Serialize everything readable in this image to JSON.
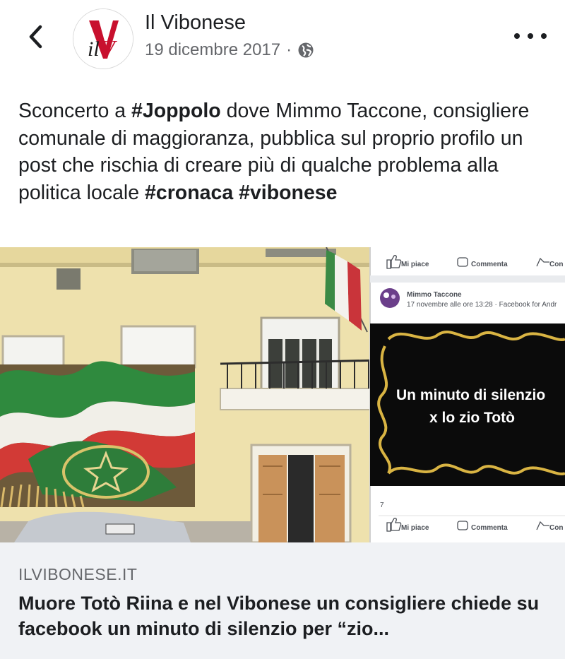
{
  "post": {
    "page_name": "Il Vibonese",
    "date": "19 dicembre 2017",
    "separator": "·",
    "avatar_text": "ilV",
    "caption": {
      "p1": "Sconcerto a ",
      "h1": "#Joppolo",
      "p2": " dove Mimmo Taccone, consigliere comunale di maggioranza, pubblica sul proprio profilo un post che rischia di creare più di qualche problema alla politica locale ",
      "h2": "#cronaca",
      "p3": " ",
      "h3": "#vibonese"
    }
  },
  "embedded_post": {
    "top_actions": {
      "like": "Mi piace",
      "comment": "Commenta",
      "share": "Con"
    },
    "author": "Mimmo Taccone",
    "timestamp": "17 novembre alle ore 13:28 · Facebook for Andr",
    "meme_line1": "Un minuto di silenzio",
    "meme_line2": "x lo zio Totò",
    "count": "7",
    "bottom_actions": {
      "like": "Mi piace",
      "comment": "Commenta",
      "share": "Con"
    }
  },
  "link_preview": {
    "domain": "ILVIBONESE.IT",
    "title": "Muore Totò Riina e nel Vibonese un consigliere chiede su facebook un minuto di silenzio per “zio..."
  },
  "colors": {
    "brand_red": "#c8102e",
    "card_bg": "#f0f2f5",
    "meta_gray": "#65676b"
  },
  "icons": {
    "back": "chevron-left-icon",
    "privacy": "globe-icon",
    "more": "more-horizontal-icon"
  }
}
